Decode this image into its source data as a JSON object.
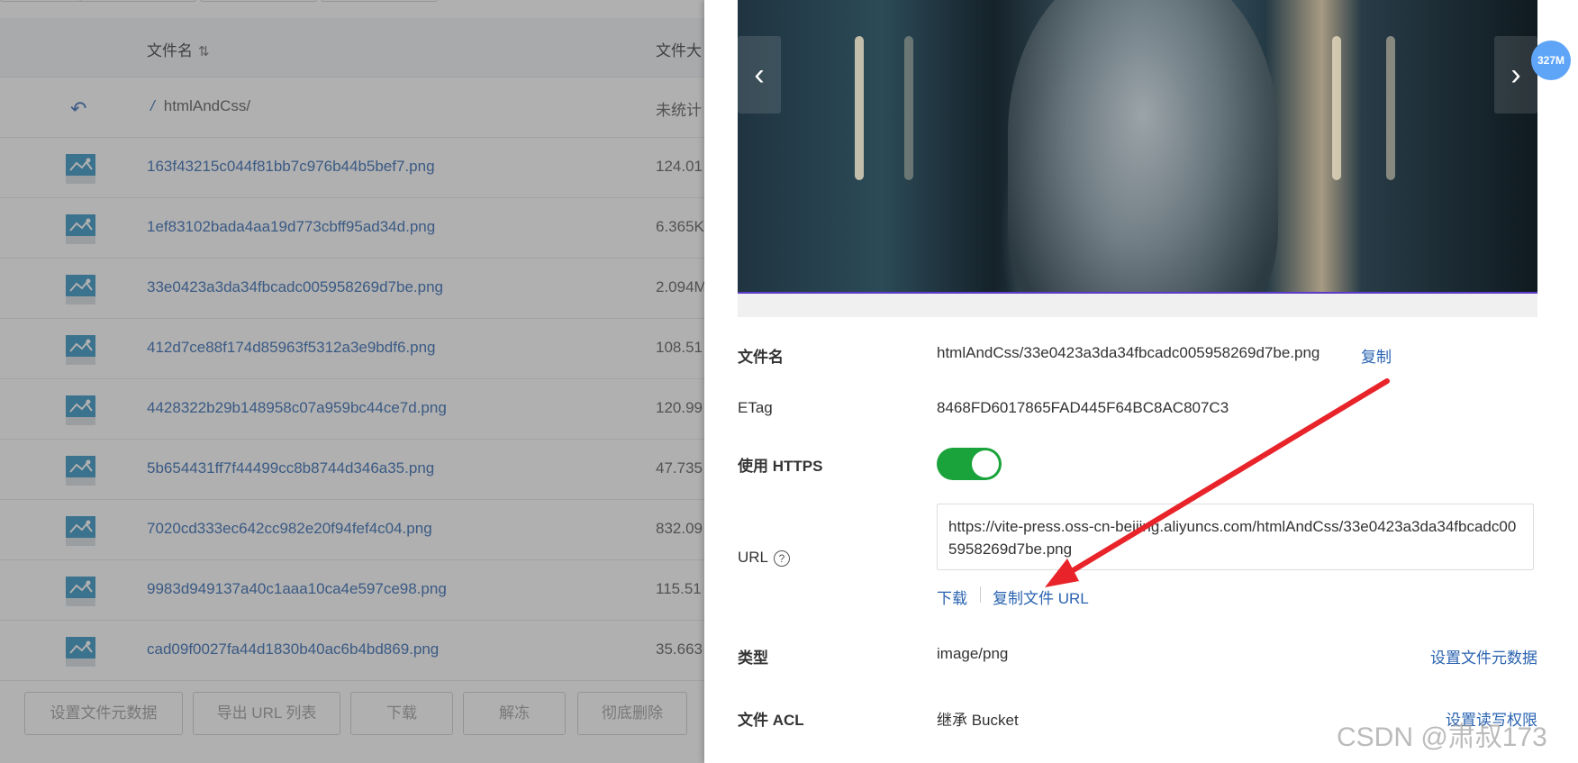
{
  "list": {
    "header": {
      "name_col": "文件名",
      "size_col": "文件大"
    },
    "path_row": {
      "path": "htmlAndCss/",
      "size": "未统计"
    },
    "rows": [
      {
        "name": "163f43215c044f81bb7c976b44b5bef7.png",
        "size": "124.01"
      },
      {
        "name": "1ef83102bada4aa19d773cbff95ad34d.png",
        "size": "6.365K"
      },
      {
        "name": "33e0423a3da34fbcadc005958269d7be.png",
        "size": "2.094M"
      },
      {
        "name": "412d7ce88f174d85963f5312a3e9bdf6.png",
        "size": "108.51"
      },
      {
        "name": "4428322b29b148958c07a959bc44ce7d.png",
        "size": "120.99"
      },
      {
        "name": "5b654431ff7f44499cc8b8744d346a35.png",
        "size": "47.735"
      },
      {
        "name": "7020cd333ec642cc982e20f94fef4c04.png",
        "size": "832.09"
      },
      {
        "name": "9983d949137a40c1aaa10ca4e597ce98.png",
        "size": "115.51"
      },
      {
        "name": "cad09f0027fa44d1830b40ac6b4bd869.png",
        "size": "35.663"
      }
    ],
    "footer_buttons": [
      "设置文件元数据",
      "导出 URL 列表",
      "下载",
      "解冻",
      "彻底删除"
    ]
  },
  "detail": {
    "badge": "327M",
    "nav": {
      "prev": "‹",
      "next": "›"
    },
    "filename_label": "文件名",
    "filename_value": "htmlAndCss/33e0423a3da34fbcadc005958269d7be.png",
    "copy_link": "复制",
    "etag_label": "ETag",
    "etag_value": "8468FD6017865FAD445F64BC8AC807C3",
    "https_label": "使用 HTTPS",
    "https_enabled": true,
    "url_label": "URL",
    "url_value": "https://vite-press.oss-cn-beijing.aliyuncs.com/htmlAndCss/33e0423a3da34fbcadc005958269d7be.png",
    "download_link": "下载",
    "copy_url_link": "复制文件 URL",
    "type_label": "类型",
    "type_value": "image/png",
    "set_meta_link": "设置文件元数据",
    "acl_label": "文件 ACL",
    "acl_value": "继承 Bucket",
    "set_acl_link": "设置读写权限"
  },
  "watermark": "CSDN @肃叔173",
  "colors": {
    "link": "#2a63b0",
    "toggle_on": "#1aa33a",
    "badge": "#5fa5f7",
    "arrow": "#e8232a"
  }
}
